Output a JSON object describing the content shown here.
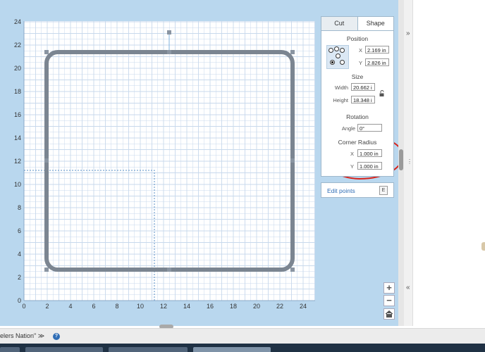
{
  "tabs": {
    "cut": "Cut",
    "shape": "Shape"
  },
  "position": {
    "title": "Position",
    "x_label": "X",
    "x_value": "2.169 in",
    "y_label": "Y",
    "y_value": "2.826 in"
  },
  "size": {
    "title": "Size",
    "width_label": "Width",
    "width_value": "20.662 i",
    "height_label": "Height",
    "height_value": "18.348 i"
  },
  "rotation": {
    "title": "Rotation",
    "angle_label": "Angle",
    "angle_value": "0°"
  },
  "corner_radius": {
    "title": "Corner Radius",
    "x_label": "X",
    "x_value": "1.000 in",
    "y_label": "Y",
    "y_value": "1.000 in"
  },
  "edit_points": {
    "label": "Edit points",
    "shortcut": "E"
  },
  "zoom": {
    "in": "+",
    "out": "−"
  },
  "side_toggle": {
    "collapse": "»",
    "expand": "«",
    "more": "⋮"
  },
  "status": {
    "text": "elers Nation\" ≫",
    "help": "?"
  },
  "canvas": {
    "x_ticks": [
      "0",
      "2",
      "4",
      "6",
      "8",
      "10",
      "12",
      "14",
      "16",
      "18",
      "20",
      "22",
      "24"
    ],
    "y_ticks": [
      "0",
      "2",
      "4",
      "6",
      "8",
      "10",
      "12",
      "14",
      "16",
      "18",
      "20",
      "22",
      "24"
    ],
    "grid_color": "#c8d9ec",
    "shape_color": "#7b8591",
    "annotation_color": "#d9241c"
  },
  "colors": {
    "workspace": "#b9d7ee",
    "link": "#2f6db5"
  }
}
